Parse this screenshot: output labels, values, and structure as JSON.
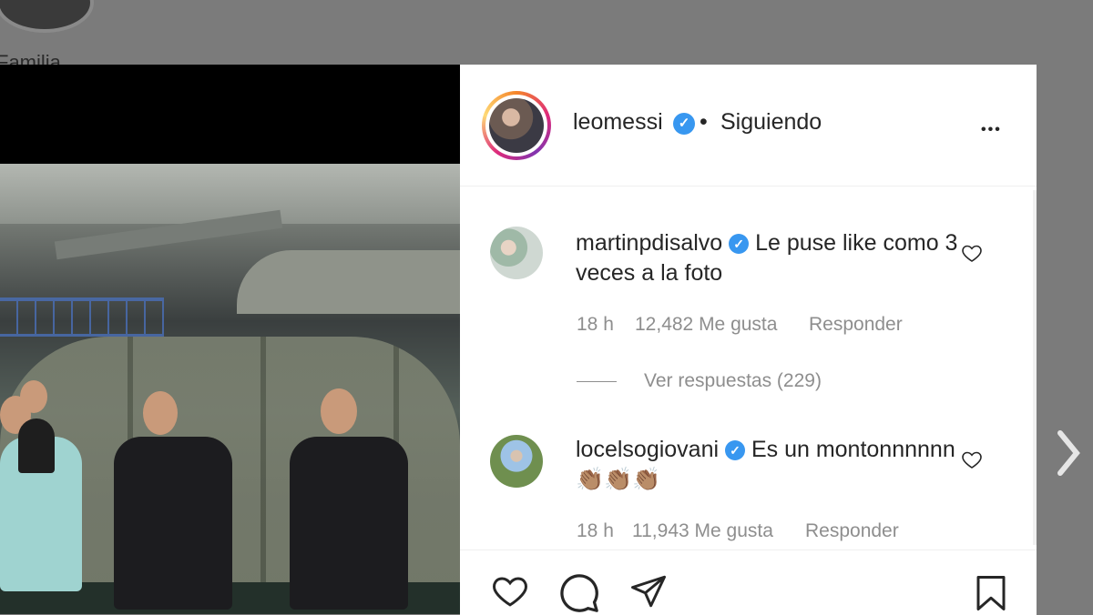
{
  "background": {
    "label": "Familia"
  },
  "post": {
    "username": "leomessi",
    "separator": "•",
    "following_label": "Siguiendo",
    "more_label": "•••"
  },
  "comments": [
    {
      "username": "martinpdisalvo",
      "text": "Le puse like como 3 veces a la foto",
      "time": "18 h",
      "likes": "12,482 Me gusta",
      "reply_label": "Responder",
      "view_replies": "Ver respuestas (229)"
    },
    {
      "username": "locelsogiovani",
      "text": "Es un montonnnnnn 👏🏽👏🏽👏🏽",
      "time": "18 h",
      "likes": "11,943 Me gusta",
      "reply_label": "Responder"
    }
  ],
  "colors": {
    "verified": "#3897f0",
    "overlay": "#7b7b7b",
    "meta": "#8e8e8e"
  },
  "icons": [
    "like-icon",
    "comment-icon",
    "share-icon",
    "save-icon",
    "next-arrow-icon",
    "more-icon",
    "verified-icon"
  ]
}
